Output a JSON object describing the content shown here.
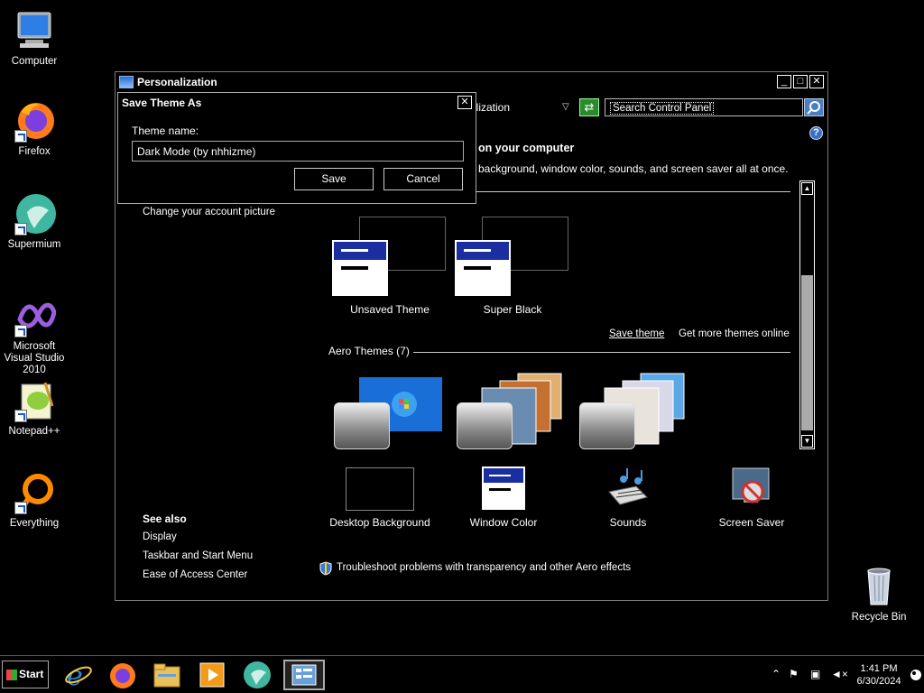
{
  "desktop": {
    "icons": [
      {
        "label": "Computer"
      },
      {
        "label": "Firefox"
      },
      {
        "label": "Supermium"
      },
      {
        "label": "Microsoft Visual Studio 2010"
      },
      {
        "label": "Notepad++"
      },
      {
        "label": "Everything"
      },
      {
        "label": "Recycle Bin"
      }
    ]
  },
  "window": {
    "title": "Personalization",
    "address_text": "alization",
    "search_placeholder": "Search Control Panel",
    "heading": "on your computer",
    "description": "background, window color, sounds, and screen saver all at once.",
    "left_link": "Change your account picture",
    "my_themes": [
      {
        "label": "Unsaved Theme"
      },
      {
        "label": "Super Black"
      }
    ],
    "save_theme": "Save theme",
    "get_more": "Get more themes online",
    "aero_section": "Aero Themes (7)",
    "bottom_items": [
      {
        "label": "Desktop Background"
      },
      {
        "label": "Window Color"
      },
      {
        "label": "Sounds"
      },
      {
        "label": "Screen Saver"
      }
    ],
    "see_also": {
      "title": "See also",
      "links": [
        "Display",
        "Taskbar and Start Menu",
        "Ease of Access Center"
      ]
    },
    "troubleshoot": "Troubleshoot problems with transparency and other Aero effects"
  },
  "dialog": {
    "title": "Save Theme As",
    "label": "Theme name:",
    "value": "Dark Mode (by nhhizme)",
    "save": "Save",
    "cancel": "Cancel",
    "close": "✕"
  },
  "taskbar": {
    "start": "Start",
    "time": "1:41 PM",
    "date": "6/30/2024"
  },
  "colors": {
    "accent_blue": "#1b2ea0",
    "refresh_green": "#2b8a2b"
  }
}
